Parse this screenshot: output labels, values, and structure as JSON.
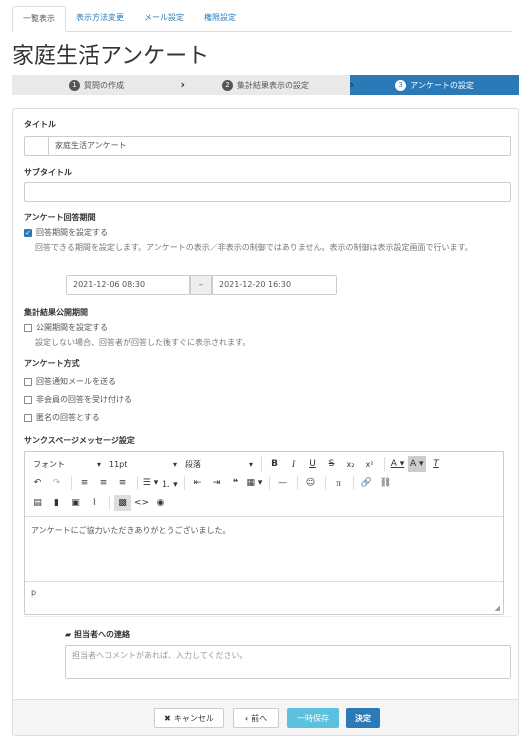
{
  "tabs": [
    "一覧表示",
    "表示方法変更",
    "メール設定",
    "権限設定"
  ],
  "page_title": "家庭生活アンケート",
  "steps": [
    {
      "num": "1",
      "label": "質問の作成"
    },
    {
      "num": "2",
      "label": "集計結果表示の設定"
    },
    {
      "num": "3",
      "label": "アンケートの設定"
    }
  ],
  "form": {
    "title_label": "タイトル",
    "title_value": "家庭生活アンケート",
    "subtitle_label": "サブタイトル",
    "subtitle_value": "",
    "period_label": "アンケート回答期間",
    "period_check": "回答期間を設定する",
    "period_help": "回答できる期間を設定します。アンケートの表示／非表示の制御ではありません。表示の制御は表示設定画面で行います。",
    "period_from": "2021-12-06 08:30",
    "period_dash": "–",
    "period_to": "2021-12-20 16:30",
    "result_label": "集計結果公開期間",
    "result_check": "公開期間を設定する",
    "result_help": "設定しない場合、回答者が回答した後すぐに表示されます。",
    "method_label": "アンケート方式",
    "method_opt1": "回答通知メールを送る",
    "method_opt2": "非会員の回答を受け付ける",
    "method_opt3": "匿名の回答とする",
    "thanks_label": "サンクスページメッセージ設定"
  },
  "editor": {
    "font_combo": "フォント",
    "size_combo": "11pt",
    "format_combo": "段落",
    "content": "アンケートにご協力いただきありがとうございました。",
    "status_path": "p"
  },
  "contact": {
    "label": "担当者への連絡",
    "placeholder": "担当者へコメントがあれば、入力してください。"
  },
  "footer": {
    "cancel": "キャンセル",
    "back": "前へ",
    "save": "一時保存",
    "submit": "決定"
  },
  "colors": {
    "accent": "#2a7ab8",
    "info": "#5bc0de"
  }
}
